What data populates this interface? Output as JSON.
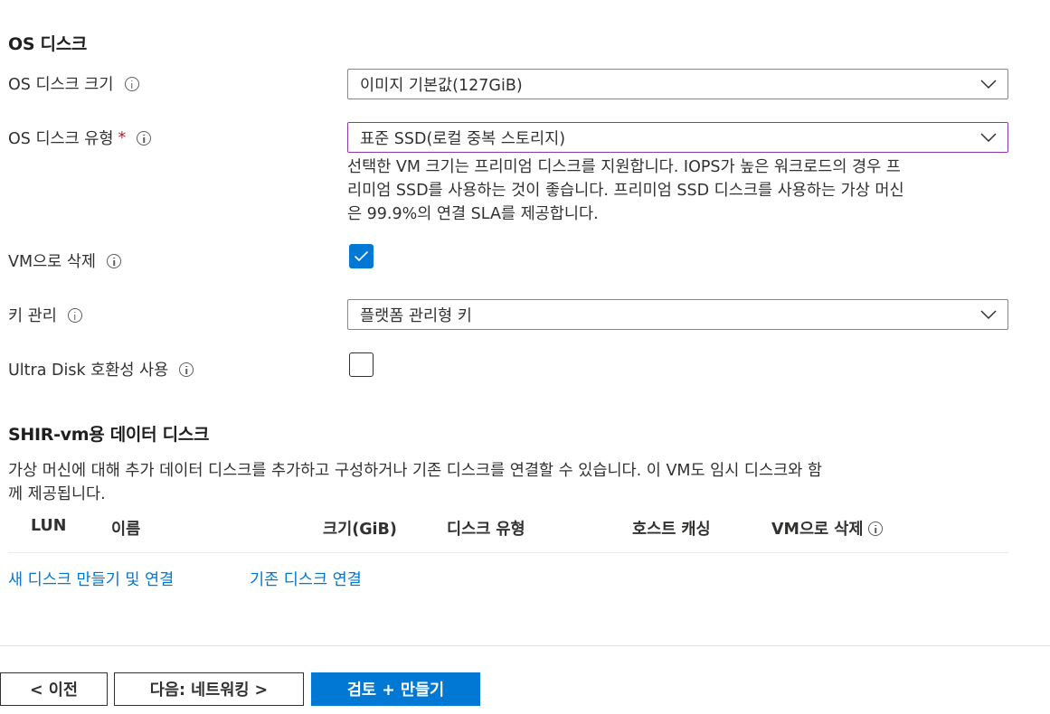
{
  "os_disk": {
    "title": "OS 디스크",
    "size": {
      "label": "OS 디스크 크기",
      "value": "이미지 기본값(127GiB)"
    },
    "type": {
      "label": "OS 디스크 유형",
      "required_mark": "*",
      "value": "표준 SSD(로컬 중복 스토리지)",
      "help_lines": [
        "선택한 VM 크기는 프리미엄 디스크를 지원합니다. IOPS가 높은 워크로드의 경우 프",
        "리미엄 SSD를 사용하는 것이 좋습니다. 프리미엄 SSD 디스크를 사용하는 가상 머신",
        "은 99.9%의 연결 SLA를 제공합니다."
      ]
    },
    "delete_with_vm": {
      "label": "VM으로 삭제",
      "checked": true
    },
    "key_management": {
      "label": "키 관리",
      "value": "플랫폼 관리형 키"
    },
    "ultra_disk": {
      "label": "Ultra Disk 호환성 사용",
      "checked": false
    }
  },
  "data_disks": {
    "title": "SHIR-vm용 데이터 디스크",
    "description_lines": [
      "가상 머신에 대해 추가 데이터 디스크를 추가하고 구성하거나 기존 디스크를 연결할 수 있습니다. 이 VM도 임시 디스크와 함",
      "께 제공됩니다."
    ],
    "columns": [
      "LUN",
      "이름",
      "크기(GiB)",
      "디스크 유형",
      "호스트 캐싱",
      "VM으로 삭제"
    ],
    "links": {
      "create": "새 디스크 만들기 및 연결",
      "attach": "기존 디스크 연결"
    }
  },
  "footer": {
    "prev": "< 이전",
    "next": "다음: 네트워킹 >",
    "review": "검토 + 만들기"
  },
  "colors": {
    "accent": "#0078d4",
    "focus_border": "#8c36a9",
    "required": "#a4262c"
  }
}
